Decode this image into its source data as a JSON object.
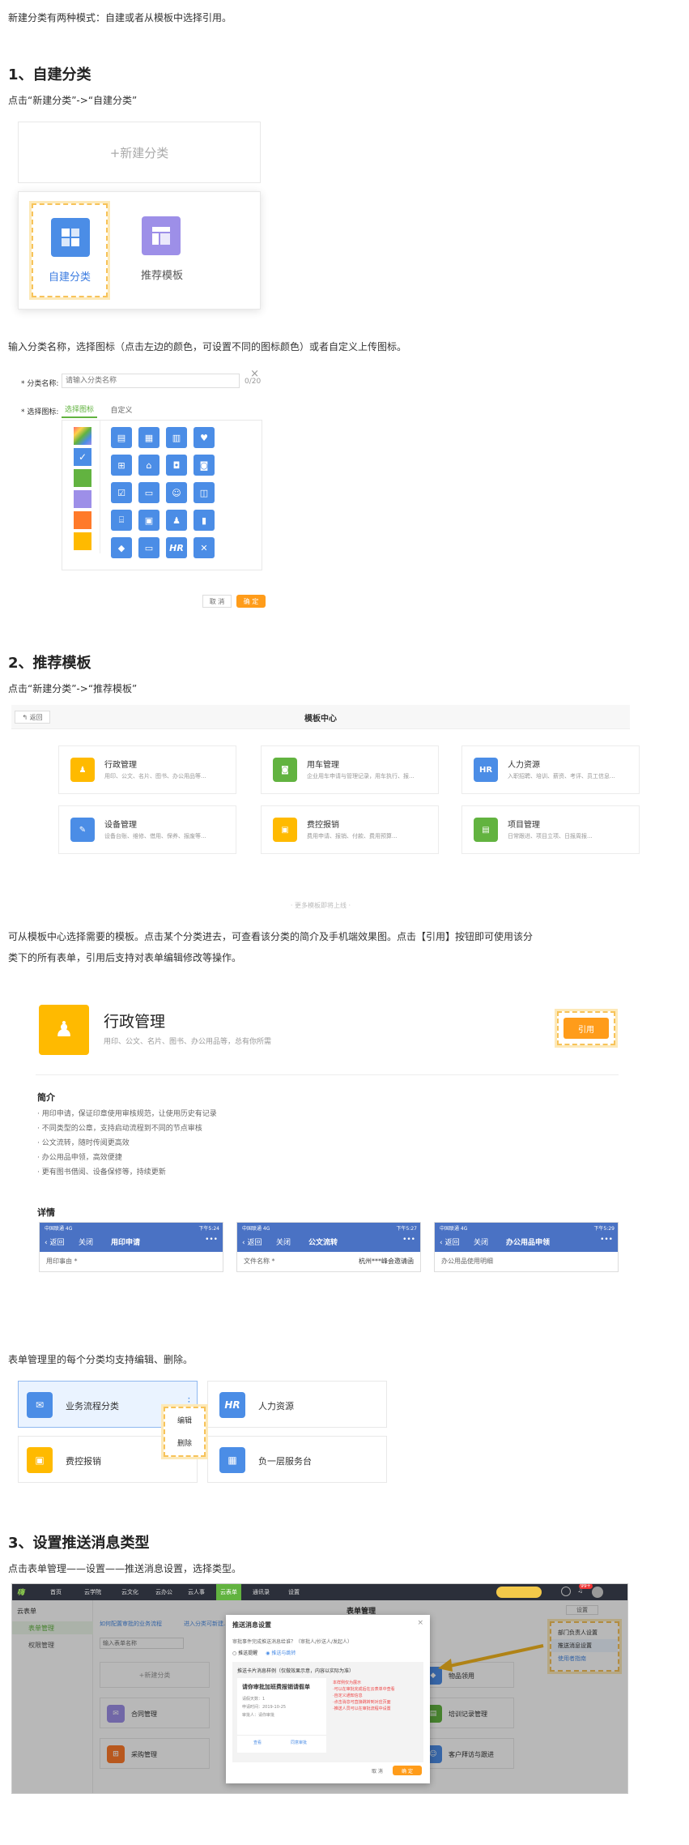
{
  "intro": "新建分类有两种模式：自建或者从模板中选择引用。",
  "s1": {
    "title": "1、自建分类",
    "step": "点击“新建分类”->“自建分类”",
    "new_category": "+新建分类",
    "self_built": "自建分类",
    "recommended": "推荐模板",
    "desc": "输入分类名称，选择图标（点击左边的颜色，可设置不同的图标颜色）或者自定义上传图标。",
    "form": {
      "name_label": "* 分类名称:",
      "name_placeholder": "请输入分类名称",
      "name_count": "0/20",
      "icon_label": "* 选择图标:",
      "tab_icon": "选择图标",
      "tab_custom": "自定义",
      "cancel": "取 消",
      "ok": "确 定",
      "colors": [
        "#4b8de6",
        "#62b340",
        "#9d8fe8",
        "#ff7a2a",
        "#ffba00"
      ]
    }
  },
  "s2": {
    "title": "2、推荐模板",
    "step": "点击“新建分类”->“推荐模板”",
    "center": {
      "back": "返回",
      "title": "模板中心",
      "more": "· 更多模板即将上线 ·",
      "items": [
        {
          "name": "行政管理",
          "desc": "用印、公文、名片、图书、办公用品等...",
          "color": "#ffba00"
        },
        {
          "name": "用车管理",
          "desc": "企业用车申请与管理记录，用车执行、报...",
          "color": "#62b340"
        },
        {
          "name": "人力资源",
          "desc": "入职招聘、培训、薪资、考评、员工信息...",
          "color": "#4b8de6"
        },
        {
          "name": "设备管理",
          "desc": "设备台账、维修、借用、保养、报废等...",
          "color": "#4b8de6"
        },
        {
          "name": "费控报销",
          "desc": "费用申请、报销、付款、费用预算...",
          "color": "#ffba00"
        },
        {
          "name": "项目管理",
          "desc": "日常跟进、项目立项、日报周报...",
          "color": "#62b340"
        }
      ]
    },
    "desc1": "可从模板中心选择需要的模板。点击某个分类进去，可查看该分类的简介及手机端效果图。点击【引用】按钮即可使用该分",
    "desc2": "类下的所有表单，引用后支持对表单编辑修改等操作。",
    "detail": {
      "title": "行政管理",
      "sub": "用印、公文、名片、图书、办公用品等，总有你所需",
      "cite": "引用",
      "intro_h": "简介",
      "intro": [
        "· 用印申请，保证印章使用审核规范，让使用历史有记录",
        "· 不同类型的公章，支持启动流程到不同的节点审核",
        "· 公文流转，随时传阅更高效",
        "· 办公用品申领，高效便捷",
        "· 更有图书借阅、设备保修等，持续更新"
      ],
      "detail_h": "详情",
      "phones": [
        {
          "status_l": "中国联通 4G",
          "status_r": "下午5:24",
          "back": "返回",
          "close": "关闭",
          "title": "用印申请",
          "more": "•••",
          "field": "用印事由 *",
          "value": ""
        },
        {
          "status_l": "中国联通 4G",
          "status_r": "下午5:27",
          "back": "返回",
          "close": "关闭",
          "title": "公文流转",
          "more": "•••",
          "field": "文件名称 *",
          "value": "杭州***峰会邀请函"
        },
        {
          "status_l": "中国联通 4G",
          "status_r": "下午5:29",
          "back": "返回",
          "close": "关闭",
          "title": "办公用品申领",
          "more": "•••",
          "field": "办公用品使用明细",
          "value": ""
        }
      ]
    }
  },
  "s_edit": {
    "desc": "表单管理里的每个分类均支持编辑、删除。",
    "cards": [
      {
        "name": "业务流程分类",
        "color": "#4b8de6"
      },
      {
        "name": "人力资源",
        "color": "#4b8de6"
      },
      {
        "name": "费控报销",
        "color": "#ffba00"
      },
      {
        "name": "负一层服务台",
        "color": "#4b8de6"
      }
    ],
    "menu_edit": "编辑",
    "menu_delete": "删除",
    "dots": "⋮"
  },
  "s3": {
    "title": "3、设置推送消息类型",
    "step": "点击表单管理——设置——推送消息设置，选择类型。",
    "ui": {
      "nav": [
        "首页",
        "云学院",
        "云文化",
        "云办公",
        "云人事",
        "云表单",
        "通讯录",
        "设置"
      ],
      "active_nav": "云表单",
      "side_head": "云表单",
      "side": [
        "表单管理",
        "权限管理"
      ],
      "page_title": "表单管理",
      "settings": "设置",
      "menu": [
        "部门负责人设置",
        "推送消息设置",
        "使用者指南"
      ],
      "search_placeholder": "输入表单名称",
      "new_cat": "+新建分类",
      "links": [
        "如何配置审批的业务流程",
        "进入分类可新建..."
      ],
      "cards_left": [
        "合同管理",
        "采购管理"
      ],
      "cards_right": [
        "物品领用",
        "培训记录管理",
        "客户拜访与跟进"
      ],
      "badge": "99+",
      "dialog": {
        "title": "推送消息设置",
        "q": "审批事件完成推送消息给谁？（审批人/抄送人/发起人）",
        "opt1": "推送提醒",
        "opt2": "推送与跳转",
        "sec": "推送卡片消息样例（仅做效果示意，内容以实际为准）",
        "card_title": "请你审批加班费报销请假单",
        "card_l1": "请假天数：1",
        "card_l2": "申请时间：2019-10-25",
        "card_l3": "审批人：请你审批",
        "card_btn1": "查看",
        "card_btn2": "同意审批",
        "notes": "本样例仅为展示\n·可以在审批完成后在云表单中查看\n·自定义通知信息\n·点击消息可直接跳转到对应页面\n·推送人员可以在审批流程中设置",
        "cancel": "取 消",
        "ok": "确 定"
      }
    }
  }
}
